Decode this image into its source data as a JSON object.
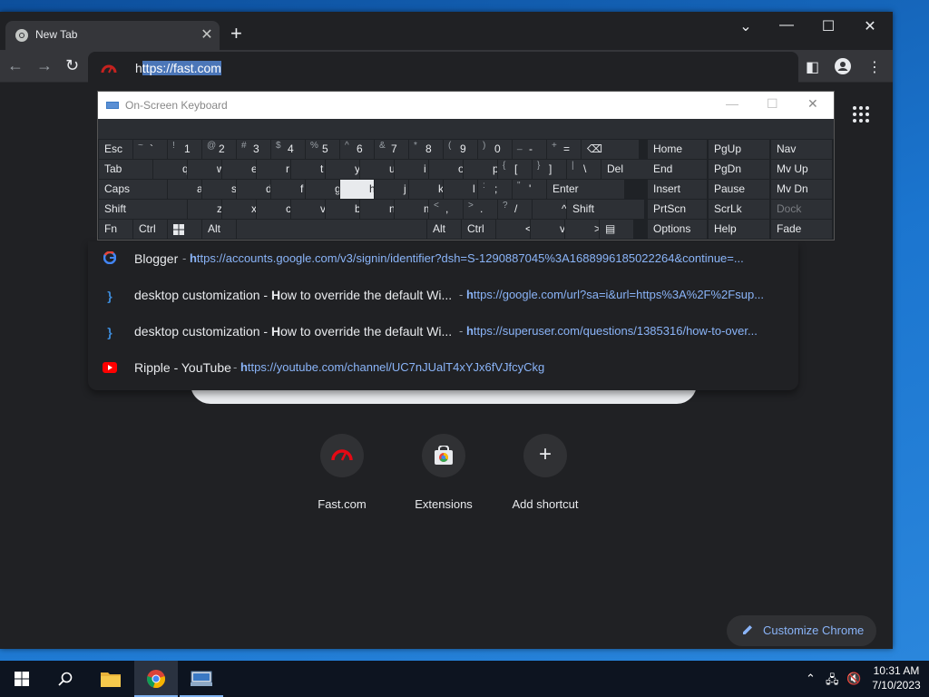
{
  "browser": {
    "tab_title": "New Tab",
    "omnibox_first_char": "h",
    "omnibox_selected": "ttps://fast.com"
  },
  "suggestions": [
    {
      "icon": "google-icon",
      "title": "Blogger",
      "url_bold": "h",
      "url": "ttps://accounts.google.com/v3/signin/identifier?dsh=S-1290887045%3A1688996185022264&continue=..."
    },
    {
      "icon": "superuser-icon",
      "title_pre": "desktop customization - ",
      "title_bold": "H",
      "title_post": "ow to override the default Wi...",
      "url_bold": "h",
      "url": "ttps://google.com/url?sa=i&url=https%3A%2F%2Fsup..."
    },
    {
      "icon": "superuser-icon",
      "title_pre": "desktop customization - ",
      "title_bold": "H",
      "title_post": "ow to override the default Wi...",
      "url_bold": "h",
      "url": "ttps://superuser.com/questions/1385316/how-to-over..."
    },
    {
      "icon": "youtube-icon",
      "title": "Ripple - YouTube",
      "url_bold": "h",
      "url": "ttps://youtube.com/channel/UC7nJUalT4xYJx6fVJfcyCkg"
    }
  ],
  "separator": "-",
  "shortcuts": [
    {
      "label": "Fast.com"
    },
    {
      "label": "Extensions"
    },
    {
      "label": "Add shortcut"
    }
  ],
  "customize_label": "Customize Chrome",
  "osk": {
    "title": "On-Screen Keyboard",
    "rows": [
      [
        [
          "Esc",
          ""
        ],
        [
          "~",
          "`"
        ],
        [
          "!",
          "1"
        ],
        [
          "@",
          "2"
        ],
        [
          "#",
          "3"
        ],
        [
          "$",
          "4"
        ],
        [
          "%",
          "5"
        ],
        [
          "^",
          "6"
        ],
        [
          "&",
          "7"
        ],
        [
          "*",
          "8"
        ],
        [
          "(",
          "9"
        ],
        [
          ")",
          "0"
        ],
        [
          "_",
          "-"
        ],
        [
          "+",
          "="
        ],
        [
          "",
          "⌫"
        ]
      ],
      [
        [
          "Tab",
          ""
        ],
        [
          "",
          "q"
        ],
        [
          "",
          "w"
        ],
        [
          "",
          "e"
        ],
        [
          "",
          "r"
        ],
        [
          "",
          "t"
        ],
        [
          "",
          "y"
        ],
        [
          "",
          "u"
        ],
        [
          "",
          "i"
        ],
        [
          "",
          "o"
        ],
        [
          "",
          "p"
        ],
        [
          "{",
          "["
        ],
        [
          "}",
          "]"
        ],
        [
          "|",
          "\\"
        ],
        [
          "Del",
          ""
        ]
      ],
      [
        [
          "Caps",
          ""
        ],
        [
          "",
          "a"
        ],
        [
          "",
          "s"
        ],
        [
          "",
          "d"
        ],
        [
          "",
          "f"
        ],
        [
          "",
          "g"
        ],
        [
          "",
          "h"
        ],
        [
          "",
          "j"
        ],
        [
          "",
          "k"
        ],
        [
          "",
          "l"
        ],
        [
          ":",
          ";"
        ],
        [
          "\"",
          "'"
        ],
        [
          "Enter",
          ""
        ]
      ],
      [
        [
          "Shift",
          ""
        ],
        [
          "",
          "z"
        ],
        [
          "",
          "x"
        ],
        [
          "",
          "c"
        ],
        [
          "",
          "v"
        ],
        [
          "",
          "b"
        ],
        [
          "",
          "n"
        ],
        [
          "",
          "m"
        ],
        [
          "<",
          ","
        ],
        [
          ">",
          "."
        ],
        [
          "?",
          "/"
        ],
        [
          "",
          "^"
        ],
        [
          "Shift",
          ""
        ]
      ],
      [
        [
          "Fn",
          ""
        ],
        [
          "Ctrl",
          ""
        ],
        [
          "",
          "win"
        ],
        [
          "Alt",
          ""
        ],
        [
          "",
          ""
        ],
        [
          "Alt",
          ""
        ],
        [
          "Ctrl",
          ""
        ],
        [
          "",
          "<"
        ],
        [
          "",
          "v"
        ],
        [
          "",
          ">"
        ],
        [
          "",
          "menu"
        ]
      ]
    ],
    "nav_keys": [
      [
        "Home",
        "PgUp",
        "Nav"
      ],
      [
        "End",
        "PgDn",
        "Mv Up"
      ],
      [
        "Insert",
        "Pause",
        "Mv Dn"
      ],
      [
        "PrtScn",
        "ScrLk",
        "Dock"
      ],
      [
        "Options",
        "Help",
        "Fade"
      ]
    ]
  },
  "clock": {
    "time": "10:31 AM",
    "date": "7/10/2023"
  }
}
